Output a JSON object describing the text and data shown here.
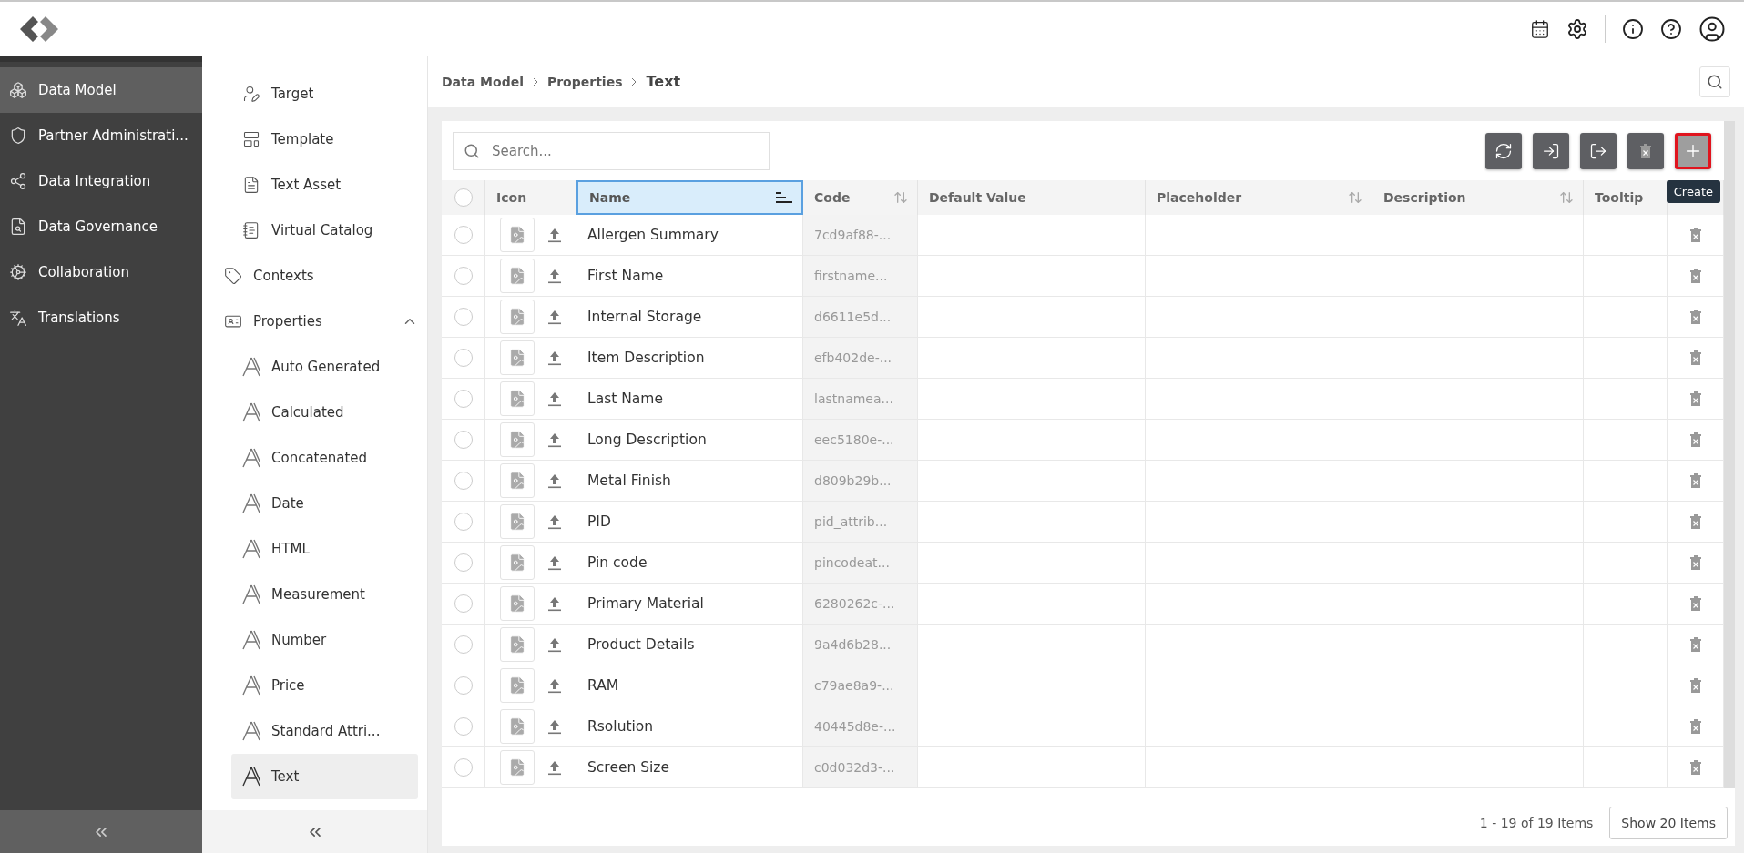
{
  "main_nav": {
    "items": [
      {
        "label": "Data Model",
        "selected": true,
        "kind": "model"
      },
      {
        "label": "Partner Administrati...",
        "selected": false,
        "kind": "partner"
      },
      {
        "label": "Data Integration",
        "selected": false,
        "kind": "integration"
      },
      {
        "label": "Data Governance",
        "selected": false,
        "kind": "governance"
      },
      {
        "label": "Collaboration",
        "selected": false,
        "kind": "collaboration"
      },
      {
        "label": "Translations",
        "selected": false,
        "kind": "translations"
      }
    ]
  },
  "sub_nav": {
    "continued_items": [
      {
        "label": "Target",
        "selected": false,
        "kind": "target"
      },
      {
        "label": "Template",
        "selected": false,
        "kind": "template"
      },
      {
        "label": "Text Asset",
        "selected": false,
        "kind": "textasset"
      },
      {
        "label": "Virtual Catalog",
        "selected": false,
        "kind": "catalog"
      }
    ],
    "items": [
      {
        "label": "Contexts",
        "selected": false,
        "kind": "contexts"
      },
      {
        "label": "Properties",
        "selected": false,
        "kind": "properties",
        "expanded": true,
        "children": [
          {
            "label": "Auto Generated",
            "selected": false,
            "kind": "attr"
          },
          {
            "label": "Calculated",
            "selected": false,
            "kind": "attr"
          },
          {
            "label": "Concatenated",
            "selected": false,
            "kind": "attr"
          },
          {
            "label": "Date",
            "selected": false,
            "kind": "attr"
          },
          {
            "label": "HTML",
            "selected": false,
            "kind": "attr"
          },
          {
            "label": "Measurement",
            "selected": false,
            "kind": "attr"
          },
          {
            "label": "Number",
            "selected": false,
            "kind": "attr"
          },
          {
            "label": "Price",
            "selected": false,
            "kind": "attr"
          },
          {
            "label": "Standard Attri...",
            "selected": false,
            "kind": "attr"
          },
          {
            "label": "Text",
            "selected": true,
            "kind": "attr"
          }
        ]
      }
    ]
  },
  "breadcrumb": [
    "Data Model",
    "Properties",
    "Text"
  ],
  "search": {
    "placeholder": "Search..."
  },
  "toolbar": {
    "buttons": [
      {
        "kind": "sync",
        "disabled": false,
        "highlighted": false
      },
      {
        "kind": "import",
        "disabled": false,
        "highlighted": false
      },
      {
        "kind": "export",
        "disabled": false,
        "highlighted": false
      },
      {
        "kind": "delete",
        "disabled": true,
        "highlighted": false
      },
      {
        "kind": "create",
        "disabled": false,
        "highlighted": true,
        "tooltip": "Create"
      }
    ]
  },
  "table": {
    "columns": [
      {
        "label": "Icon",
        "sortable": false,
        "sorted": false
      },
      {
        "label": "Name",
        "sortable": true,
        "sorted": true
      },
      {
        "label": "Code",
        "sortable": true,
        "sorted": false
      },
      {
        "label": "Default Value",
        "sortable": false,
        "sorted": false
      },
      {
        "label": "Placeholder",
        "sortable": true,
        "sorted": false
      },
      {
        "label": "Description",
        "sortable": true,
        "sorted": false
      },
      {
        "label": "Tooltip",
        "sortable": false,
        "sorted": false
      }
    ],
    "all_selected": false,
    "rows": [
      {
        "name": "Allergen Summary",
        "code": "7cd9af88-...",
        "selected": false
      },
      {
        "name": "First Name",
        "code": "firstname...",
        "selected": false
      },
      {
        "name": "Internal Storage",
        "code": "d6611e5d...",
        "selected": false
      },
      {
        "name": "Item Description",
        "code": "efb402de-...",
        "selected": false
      },
      {
        "name": "Last Name",
        "code": "lastnamea...",
        "selected": false
      },
      {
        "name": "Long Description",
        "code": "eec5180e-...",
        "selected": false
      },
      {
        "name": "Metal Finish",
        "code": "d809b29b...",
        "selected": false
      },
      {
        "name": "PID",
        "code": "pid_attrib...",
        "selected": false
      },
      {
        "name": "Pin code",
        "code": "pincodeat...",
        "selected": false
      },
      {
        "name": "Primary Material",
        "code": "6280262c-...",
        "selected": false
      },
      {
        "name": "Product Details",
        "code": "9a4d6b28...",
        "selected": false
      },
      {
        "name": "RAM",
        "code": "c79ae8a9-...",
        "selected": false
      },
      {
        "name": "Rsolution",
        "code": "40445d8e-...",
        "selected": false
      },
      {
        "name": "Screen Size",
        "code": "c0d032d3-...",
        "selected": false
      }
    ]
  },
  "pagination": {
    "summary": "1 - 19 of 19 Items",
    "page_size": "Show 20 Items"
  }
}
